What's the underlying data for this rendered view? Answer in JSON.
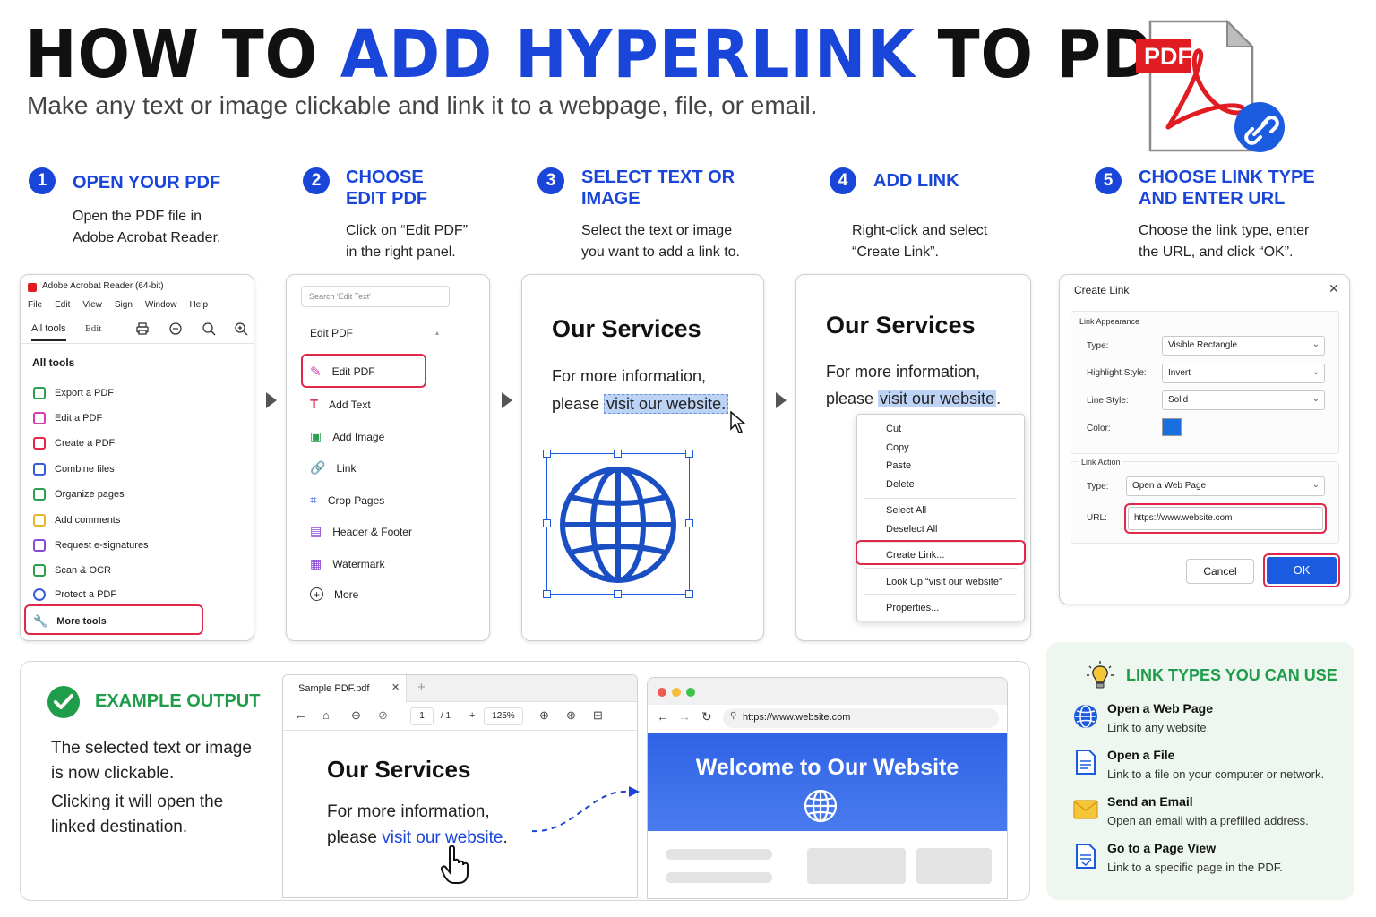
{
  "header": {
    "title_part1": "HOW TO ",
    "title_accent": "ADD HYPERLINK",
    "title_part2": " TO PDF",
    "subtitle": "Make any text or image clickable and link it to a webpage, file, or email.",
    "pdf_badge": "PDF"
  },
  "steps": [
    {
      "num": "1",
      "title_l1": "OPEN YOUR PDF",
      "title_l2": "",
      "desc_l1": "Open the PDF file in",
      "desc_l2": "Adobe Acrobat Reader."
    },
    {
      "num": "2",
      "title_l1": "CHOOSE",
      "title_l2": "EDIT PDF",
      "desc_l1": "Click on “Edit PDF”",
      "desc_l2": "in the right panel."
    },
    {
      "num": "3",
      "title_l1": "SELECT TEXT OR",
      "title_l2": "IMAGE",
      "desc_l1": "Select the text or image",
      "desc_l2": "you want to add a link to."
    },
    {
      "num": "4",
      "title_l1": "ADD LINK",
      "title_l2": "",
      "desc_l1": "Right-click and select",
      "desc_l2": "“Create Link”."
    },
    {
      "num": "5",
      "title_l1": "CHOOSE LINK TYPE",
      "title_l2": "AND ENTER URL",
      "desc_l1": "Choose the link type, enter",
      "desc_l2": "the URL, and click “OK”."
    }
  ],
  "panel1": {
    "window_title": "Adobe Acrobat Reader (64-bit)",
    "menu": [
      "File",
      "Edit",
      "View",
      "Sign",
      "Window",
      "Help"
    ],
    "tab_all_tools": "All tools",
    "tab_edit": "Edit",
    "section": "All tools",
    "items": [
      "Export a PDF",
      "Edit a PDF",
      "Create a PDF",
      "Combine files",
      "Organize pages",
      "Add comments",
      "Request e-signatures",
      "Scan & OCR",
      "Protect a PDF",
      "More tools"
    ]
  },
  "panel2": {
    "search_placeholder": "Search 'Edit Text'",
    "heading": "Edit PDF",
    "items": [
      "Edit PDF",
      "Add Text",
      "Add Image",
      "Link",
      "Crop Pages",
      "Header & Footer",
      "Watermark",
      "More"
    ]
  },
  "panel3": {
    "heading": "Our Services",
    "line1": "For more information,",
    "line2_prefix": "please ",
    "line2_link": "visit our website."
  },
  "panel4": {
    "heading": "Our Services",
    "line1": "For more information,",
    "line2_prefix": "please ",
    "line2_link": "visit our website",
    "line2_suffix": ".",
    "menu": [
      "Cut",
      "Copy",
      "Paste",
      "Delete",
      "Select All",
      "Deselect All",
      "Create Link...",
      "Look Up “visit our website”",
      "Properties..."
    ]
  },
  "dialog": {
    "title": "Create Link",
    "appearance_label": "Link Appearance",
    "type_label": "Type:",
    "type_value": "Visible Rectangle",
    "highlight_label": "Highlight Style:",
    "highlight_value": "Invert",
    "line_label": "Line Style:",
    "line_value": "Solid",
    "color_label": "Color:",
    "color_value": "#1a6fe0",
    "action_label": "Link Action",
    "action_type_label": "Type:",
    "action_type_value": "Open a Web Page",
    "url_label": "URL:",
    "url_value": "https://www.website.com",
    "cancel": "Cancel",
    "ok": "OK"
  },
  "example": {
    "title": "EXAMPLE OUTPUT",
    "p1_l1": "The selected text or image",
    "p1_l2": "is now clickable.",
    "p2_l1": "Clicking it will open the",
    "p2_l2": "linked destination.",
    "tab": "Sample PDF.pdf",
    "page_cur": "1",
    "page_total": "/ 1",
    "zoom": "125%",
    "doc_heading": "Our Services",
    "doc_line1": "For more information,",
    "doc_line2_prefix": "please ",
    "doc_line2_link": "visit our website",
    "doc_line2_suffix": ".",
    "browser_url": "https://www.website.com",
    "browser_heading": "Welcome to Our Website"
  },
  "link_types": {
    "title": "LINK TYPES YOU CAN USE",
    "items": [
      {
        "title": "Open a Web Page",
        "desc": "Link to any website."
      },
      {
        "title": "Open a File",
        "desc": "Link to a file on your computer or network."
      },
      {
        "title": "Send an Email",
        "desc": "Open an email with a prefilled address."
      },
      {
        "title": "Go to a Page View",
        "desc": "Link to a specific page in the PDF."
      }
    ]
  },
  "colors": {
    "accent": "#1a45d9",
    "highlight_red": "#e0294a",
    "success_green": "#1f9d4a",
    "selection_blue": "#bcd3f5"
  }
}
